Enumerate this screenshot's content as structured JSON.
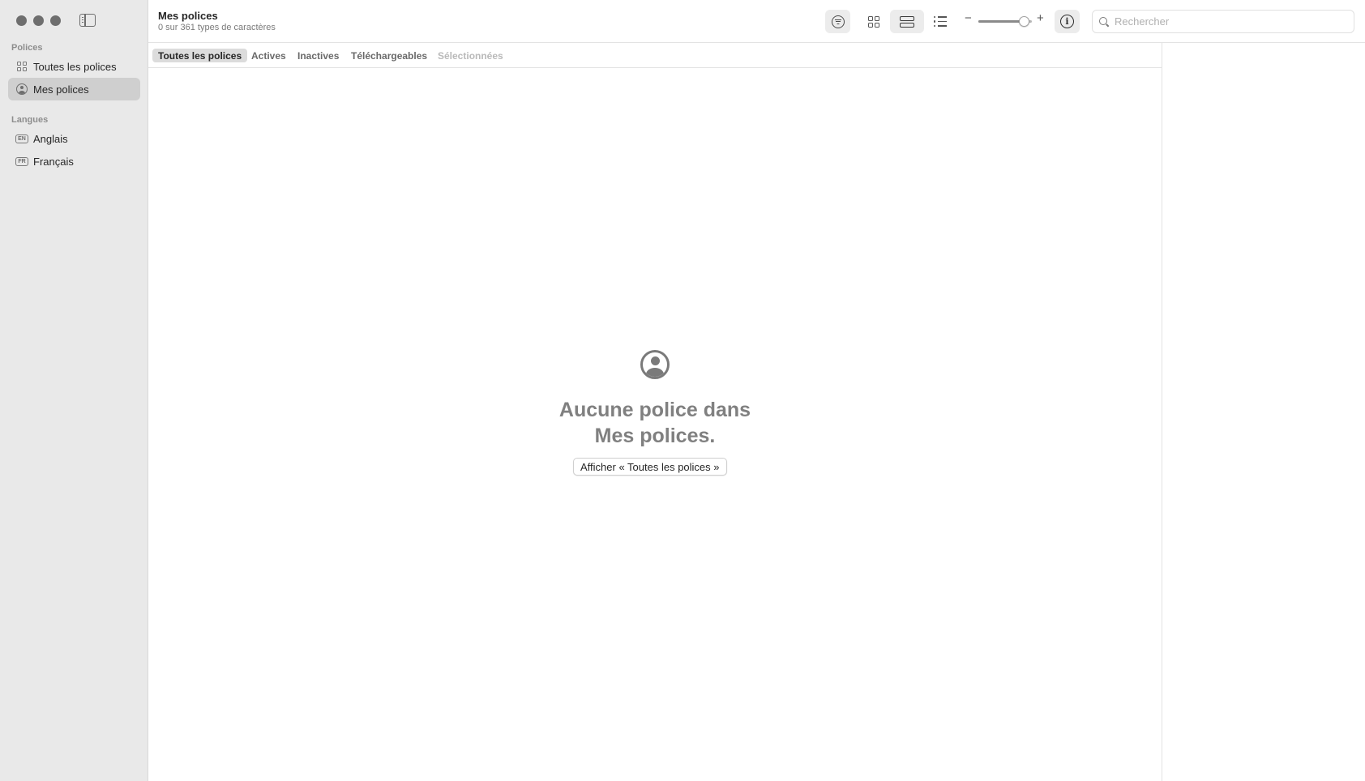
{
  "toolbar": {
    "title": "Mes polices",
    "subtitle": "0 sur 361 types de caractères",
    "zoom_minus": "−",
    "zoom_plus": "+",
    "zoom_level": 0.85,
    "info_glyph": "i",
    "search_placeholder": "Rechercher"
  },
  "sidebar": {
    "fonts_section": "Polices",
    "items": [
      {
        "label": "Toutes les polices",
        "icon": "grid-icon",
        "selected": false
      },
      {
        "label": "Mes polices",
        "icon": "person-circle-icon",
        "selected": true
      }
    ],
    "languages_section": "Langues",
    "languages": [
      {
        "badge": "EN",
        "label": "Anglais"
      },
      {
        "badge": "FR",
        "label": "Français"
      }
    ]
  },
  "filters": {
    "tabs": [
      {
        "label": "Toutes les polices",
        "state": "active"
      },
      {
        "label": "Actives",
        "state": "normal"
      },
      {
        "label": "Inactives",
        "state": "normal"
      },
      {
        "label": "Téléchargeables",
        "state": "normal"
      },
      {
        "label": "Sélectionnées",
        "state": "disabled"
      }
    ]
  },
  "empty_state": {
    "icon": "person-circle-icon",
    "title_line1": "Aucune police dans",
    "title_line2": "Mes polices.",
    "button_label": "Afficher « Toutes les polices »"
  }
}
